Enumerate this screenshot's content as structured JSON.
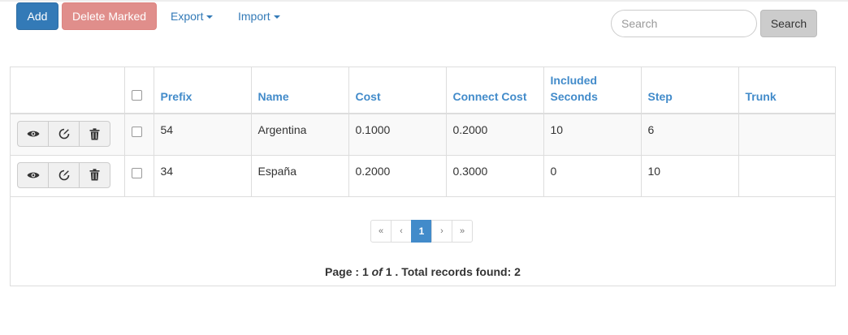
{
  "toolbar": {
    "add_label": "Add",
    "delete_label": "Delete Marked",
    "export_label": "Export",
    "import_label": "Import",
    "search_placeholder": "Search",
    "search_button": "Search"
  },
  "table": {
    "columns": [
      "Prefix",
      "Name",
      "Cost",
      "Connect Cost",
      "Included Seconds",
      "Step",
      "Trunk"
    ],
    "rows": [
      {
        "prefix": "54",
        "name": "Argentina",
        "cost": "0.1000",
        "connect_cost": "0.2000",
        "included_seconds": "10",
        "step": "6",
        "trunk": ""
      },
      {
        "prefix": "34",
        "name": "España",
        "cost": "0.2000",
        "connect_cost": "0.3000",
        "included_seconds": "0",
        "step": "10",
        "trunk": ""
      }
    ]
  },
  "pagination": {
    "first": "«",
    "prev": "‹",
    "current": "1",
    "next": "›",
    "last": "»"
  },
  "summary": {
    "page_label": "Page :",
    "page": "1",
    "of_label": "of",
    "total_pages": "1",
    "records_label": ". Total records found:",
    "total_records": "2"
  },
  "icons": [
    "eye-icon",
    "edit-icon",
    "trash-icon",
    "caret-down-icon"
  ],
  "colors": {
    "primary": "#337ab7",
    "danger": "#e08e8b",
    "link": "#428bca"
  }
}
